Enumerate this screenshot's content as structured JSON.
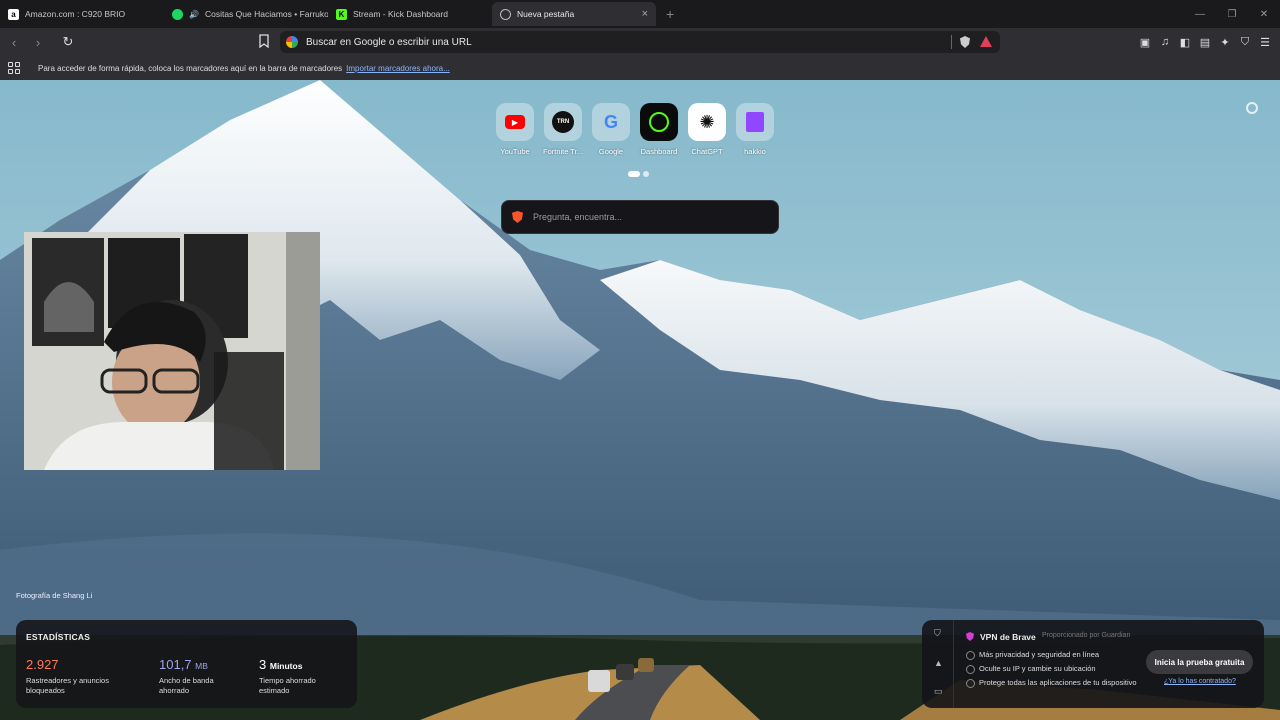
{
  "tabs": [
    {
      "title": "Amazon.com : C920 BRIO",
      "icon": "amazon-icon",
      "active": false
    },
    {
      "title": "Cositas Que Haciamos • Farruko",
      "icon": "spotify-icon",
      "active": false
    },
    {
      "title": "Stream - Kick Dashboard",
      "icon": "kick-icon",
      "active": false
    },
    {
      "title": "Nueva pestaña",
      "icon": "brave-icon",
      "active": true
    }
  ],
  "toolbar": {
    "url_placeholder": "Buscar en Google o escribir una URL"
  },
  "bookmarks_bar": {
    "message": "Para acceder de forma rápida, coloca los marcadores aquí en la barra de marcadores",
    "import_link": "Importar marcadores ahora..."
  },
  "top_sites": [
    {
      "label": "YouTube",
      "icon": "youtube-icon"
    },
    {
      "label": "Fortnite Tr...",
      "icon": "fortnite-tracker-icon"
    },
    {
      "label": "Google",
      "icon": "google-icon"
    },
    {
      "label": "Dashboard",
      "icon": "dashboard-icon"
    },
    {
      "label": "ChatGPT",
      "icon": "chatgpt-icon"
    },
    {
      "label": "hakkio",
      "icon": "twitch-icon"
    }
  ],
  "search": {
    "placeholder": "Pregunta, encuentra..."
  },
  "photo_credit": "Fotografía de Shang Li",
  "stats": {
    "title": "ESTADÍSTICAS",
    "blocked_value": "2.927",
    "blocked_label_1": "Rastreadores y anuncios",
    "blocked_label_2": "bloqueados",
    "bandwidth_value": "101,7",
    "bandwidth_unit": "MB",
    "bandwidth_label_1": "Ancho de banda",
    "bandwidth_label_2": "ahorrado",
    "time_value": "3",
    "time_unit": "Minutos",
    "time_label_1": "Tiempo ahorrado",
    "time_label_2": "estimado",
    "colors": {
      "blocked": "#ff7a59",
      "bandwidth": "#a0a5eb",
      "time": "#ffffff"
    }
  },
  "vpn": {
    "title": "VPN de Brave",
    "powered_by": "Proporcionado por Guardian",
    "features": [
      "Más privacidad y seguridad en línea",
      "Oculte su IP y cambie su ubicación",
      "Protege todas las aplicaciones de tu dispositivo"
    ],
    "cta": "Inicia la prueba gratuita",
    "already": "¿Ya lo has contratado?"
  }
}
